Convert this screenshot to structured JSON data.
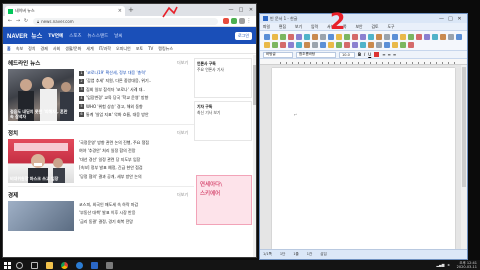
{
  "browser": {
    "tab_title": "네이버 뉴스",
    "url": "news.naver.com",
    "window_buttons": [
      "—",
      "□",
      "✕"
    ]
  },
  "naver": {
    "logo": "NAVER",
    "logo_suffix": "뉴스",
    "nav": [
      "TV연예",
      "스포츠",
      "뉴스스탠드",
      "날씨"
    ],
    "login": "로그인",
    "categories": [
      "홈",
      "속보",
      "정치",
      "경제",
      "사회",
      "생활/문화",
      "세계",
      "IT/과학",
      "오피니언",
      "포토",
      "TV",
      "랭킹뉴스"
    ]
  },
  "sections": {
    "headline": {
      "title": "헤드라인 뉴스",
      "more": "더보기",
      "caption": "걸음도 내딛지 못한 '피해자', 혼란 속 참석자",
      "items": [
        "'코로나19' 확산세, 정부 대응 '총력'",
        "'감염 추세' 지원, 다른 중앙대응, 위기..",
        "집회 일부 참석자 '코로나' 사례 대..",
        "'입장변경' 교육 당국 '학교 운영' 방향",
        "WHO '위험 상승' 경고, 해외 동향",
        "통계 '실업 지표' 악화 흐름, 대응 방안"
      ]
    },
    "politics": {
      "title": "정치",
      "more": "더보기",
      "caption": "비대위원장 마스크 쓰고 입장",
      "items": [
        "'국정운영' 방향 관련 논의 진행, 주요 쟁점",
        "여야 '추경안' 처리 일정 합의 전망",
        "'대선 경선' 일정 관련 당 지도부 입장",
        "[속보] 정부 발표 예정, 긴급 현안 점검",
        "'당정 협의' 결과 공개, 세부 방안 논의"
      ]
    },
    "economy": {
      "title": "경제",
      "more": "더보기",
      "items": [
        "코스피, 외국인 매도세 속 하락 마감",
        "'부동산 대책' 발표 이후 시장 반응",
        "'금리 동결' 결정, 경기 회복 전망"
      ]
    }
  },
  "sidebar": {
    "box1_title": "언론사 구독",
    "box1_text": "주요 언론사 기사",
    "box2_title": "기자 구독",
    "box2_text": "최신 기사 보기",
    "ad_line1": "연세아다\\",
    "ad_line2": "스키에어"
  },
  "hwp": {
    "title": "빈 문서 1 - 한글",
    "menus": [
      "파일",
      "편집",
      "보기",
      "입력",
      "서식",
      "쪽",
      "보안",
      "검토",
      "도구"
    ],
    "style_box": "바탕글",
    "font_box": "함초롬바탕",
    "size_box": "10.0",
    "page_marker": "↵",
    "status": [
      "1/1쪽",
      "1단",
      "1줄",
      "1칸",
      "삽입"
    ],
    "window_buttons": [
      "—",
      "□",
      "✕"
    ]
  },
  "annotations": {
    "label_two": "2"
  },
  "taskbar": {
    "time": "오후 12:41",
    "date": "2020-03-11"
  },
  "colors": {
    "naver_blue": "#1a4fb8",
    "naver_green": "#03c75a",
    "hwp_blue": "#dbe7f7",
    "annotation_red": "#e8202a",
    "ad_pink": "#f2a3b8"
  }
}
